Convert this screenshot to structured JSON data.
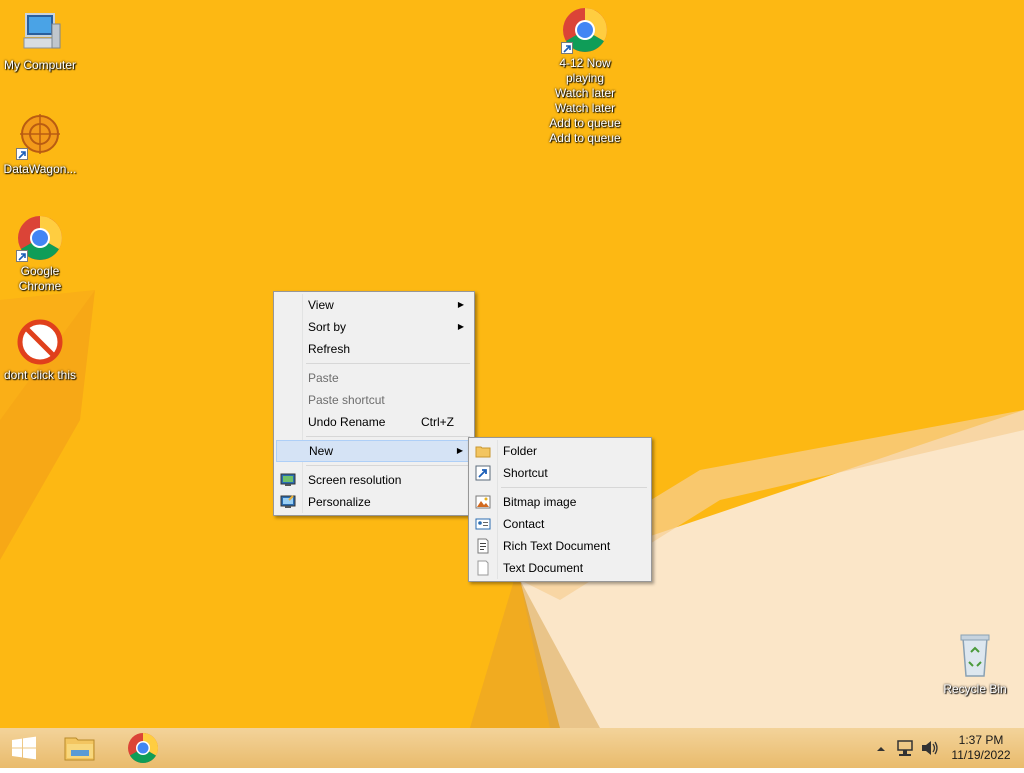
{
  "desktop": {
    "icons": [
      {
        "label": "My Computer"
      },
      {
        "label": "DataWagon..."
      },
      {
        "label": "Google\nChrome"
      },
      {
        "label": "dont click this"
      },
      {
        "label": "4-12 Now\nplaying\nWatch later\nWatch later\nAdd to queue\nAdd to queue"
      },
      {
        "label": "Recycle Bin"
      }
    ]
  },
  "context_menu": {
    "items": [
      {
        "label": "View"
      },
      {
        "label": "Sort by"
      },
      {
        "label": "Refresh"
      },
      {
        "label": "Paste"
      },
      {
        "label": "Paste shortcut"
      },
      {
        "label": "Undo Rename",
        "shortcut": "Ctrl+Z"
      },
      {
        "label": "New"
      },
      {
        "label": "Screen resolution"
      },
      {
        "label": "Personalize"
      }
    ]
  },
  "new_submenu": {
    "items": [
      {
        "label": "Folder"
      },
      {
        "label": "Shortcut"
      },
      {
        "label": "Bitmap image"
      },
      {
        "label": "Contact"
      },
      {
        "label": "Rich Text Document"
      },
      {
        "label": "Text Document"
      }
    ]
  },
  "taskbar": {
    "clock_time": "1:37 PM",
    "clock_date": "11/19/2022"
  },
  "colors": {
    "desktop_bg": "#fdb813",
    "menu_bg": "#f0f0f0",
    "menu_hover": "#d5e3f5"
  }
}
